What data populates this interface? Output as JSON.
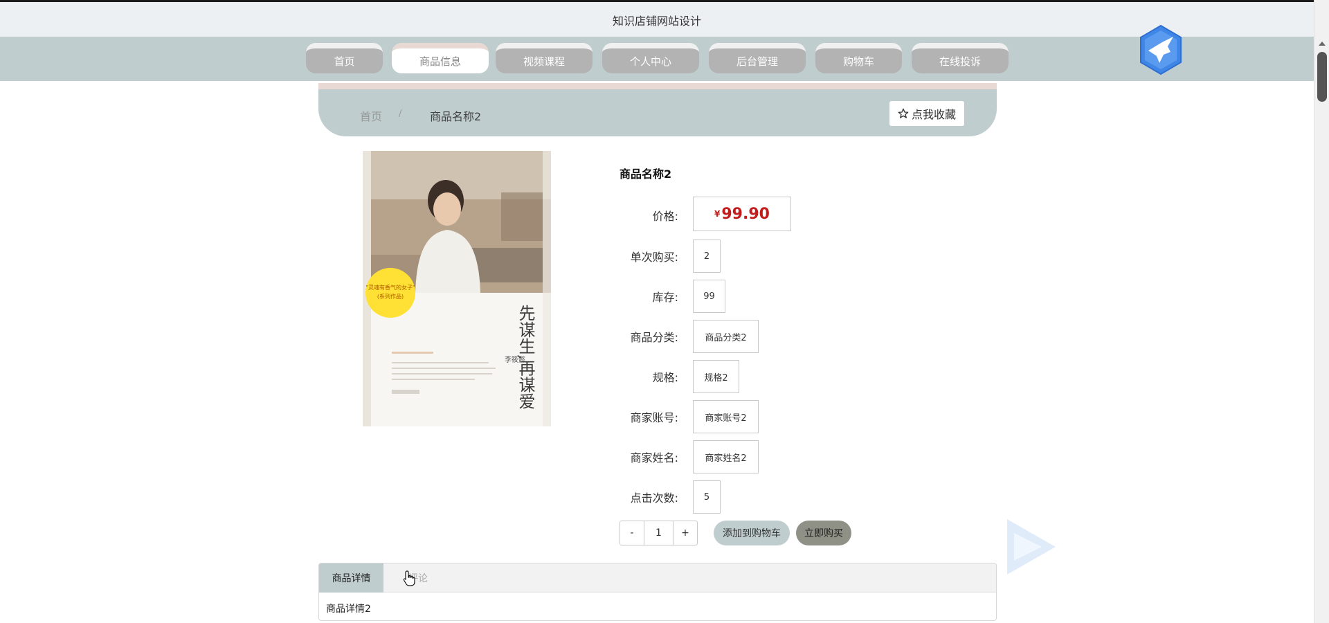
{
  "site": {
    "title": "知识店铺网站设计"
  },
  "nav": {
    "items": [
      {
        "label": "首页"
      },
      {
        "label": "商品信息"
      },
      {
        "label": "视频课程"
      },
      {
        "label": "个人中心"
      },
      {
        "label": "后台管理"
      },
      {
        "label": "购物车"
      },
      {
        "label": "在线投诉"
      }
    ],
    "active_index": 1
  },
  "breadcrumb": {
    "home": "首页",
    "separator": "/",
    "current": "商品名称2"
  },
  "favorite": {
    "label": "点我收藏",
    "icon": "star-outline-icon"
  },
  "product": {
    "name": "商品名称2",
    "price_symbol": "¥",
    "price": "99.90",
    "fields": [
      {
        "label": "价格:"
      },
      {
        "label": "单次购买:",
        "value": "2"
      },
      {
        "label": "库存:",
        "value": "99"
      },
      {
        "label": "商品分类:",
        "value": "商品分类2"
      },
      {
        "label": "规格:",
        "value": "规格2"
      },
      {
        "label": "商家账号:",
        "value": "商家账号2"
      },
      {
        "label": "商家姓名:",
        "value": "商家姓名2"
      },
      {
        "label": "点击次数:",
        "value": "5"
      }
    ],
    "cover": {
      "title": "先谋生,再谋爱",
      "author": "李筱懿",
      "badge_line1": "\"灵魂有香气的女子\"",
      "badge_line2": "(系列作品)"
    }
  },
  "quantity": {
    "minus": "-",
    "value": "1",
    "plus": "+"
  },
  "actions": {
    "add_to_cart": "添加到购物车",
    "buy_now": "立即购买"
  },
  "tabs": {
    "items": [
      {
        "label": "商品详情"
      },
      {
        "label": "评论"
      }
    ],
    "content": "商品详情2"
  },
  "colors": {
    "accent": "#bfcdcf",
    "accent_top": "#e8d9d4",
    "price": "#c21d1d",
    "nav_inactive": "#b3b3b3",
    "buy_button": "#8f9186"
  }
}
